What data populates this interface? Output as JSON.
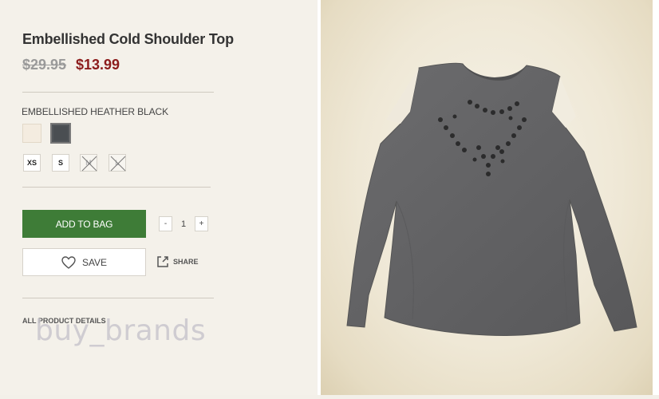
{
  "product": {
    "title": "Embellished Cold Shoulder Top",
    "original_price": "$29.95",
    "sale_price": "$13.99",
    "color_name": "EMBELLISHED HEATHER BLACK",
    "swatches": [
      {
        "name": "natural-swatch",
        "color": "#f4ece0"
      },
      {
        "name": "heather-black-swatch",
        "color": "#4a4e52",
        "selected": true
      }
    ],
    "sizes": [
      {
        "label": "XS",
        "available": true
      },
      {
        "label": "S",
        "available": true
      },
      {
        "label": "M",
        "available": false
      },
      {
        "label": "L",
        "available": false
      }
    ]
  },
  "actions": {
    "add_to_bag": "ADD TO BAG",
    "qty_minus": "-",
    "qty_value": "1",
    "qty_plus": "+",
    "save": "SAVE",
    "share": "SHARE",
    "details": "ALL PRODUCT DETAILS"
  },
  "colors": {
    "accent_green": "#3e7c37",
    "sale_red": "#8c1c1c"
  },
  "watermark": "buy_brands"
}
